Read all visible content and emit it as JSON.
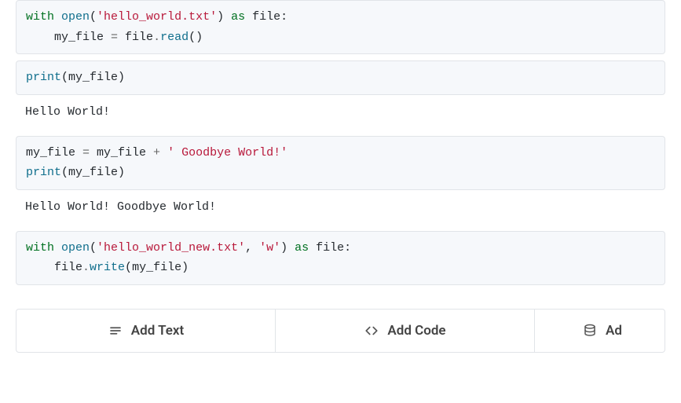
{
  "cells": [
    {
      "code_tokens": [
        [
          {
            "t": "with ",
            "c": "kw"
          },
          {
            "t": "open",
            "c": "fn"
          },
          {
            "t": "(",
            "c": "paren"
          },
          {
            "t": "'hello_world.txt'",
            "c": "str"
          },
          {
            "t": ")",
            "c": "paren"
          },
          {
            "t": " as ",
            "c": "kw"
          },
          {
            "t": "file",
            "c": "name-def"
          },
          {
            "t": ":",
            "c": "paren"
          }
        ],
        [
          {
            "t": "    my_file ",
            "c": "name-def"
          },
          {
            "t": "=",
            "c": "op"
          },
          {
            "t": " file",
            "c": "name-def"
          },
          {
            "t": ".",
            "c": "op"
          },
          {
            "t": "read",
            "c": "fn"
          },
          {
            "t": "()",
            "c": "paren"
          }
        ]
      ],
      "output": null
    },
    {
      "code_tokens": [
        [
          {
            "t": "print",
            "c": "fn"
          },
          {
            "t": "(",
            "c": "paren"
          },
          {
            "t": "my_file",
            "c": "name-def"
          },
          {
            "t": ")",
            "c": "paren"
          }
        ]
      ],
      "output": "Hello World!"
    },
    {
      "code_tokens": [
        [
          {
            "t": "my_file ",
            "c": "name-def"
          },
          {
            "t": "=",
            "c": "op"
          },
          {
            "t": " my_file ",
            "c": "name-def"
          },
          {
            "t": "+",
            "c": "op"
          },
          {
            "t": " ' Goodbye World!'",
            "c": "str"
          }
        ],
        [
          {
            "t": "print",
            "c": "fn"
          },
          {
            "t": "(",
            "c": "paren"
          },
          {
            "t": "my_file",
            "c": "name-def"
          },
          {
            "t": ")",
            "c": "paren"
          }
        ]
      ],
      "output": "Hello World! Goodbye World!"
    },
    {
      "code_tokens": [
        [
          {
            "t": "with ",
            "c": "kw"
          },
          {
            "t": "open",
            "c": "fn"
          },
          {
            "t": "(",
            "c": "paren"
          },
          {
            "t": "'hello_world_new.txt'",
            "c": "str"
          },
          {
            "t": ", ",
            "c": "paren"
          },
          {
            "t": "'w'",
            "c": "str"
          },
          {
            "t": ")",
            "c": "paren"
          },
          {
            "t": " as ",
            "c": "kw"
          },
          {
            "t": "file",
            "c": "name-def"
          },
          {
            "t": ":",
            "c": "paren"
          }
        ],
        [
          {
            "t": "    file",
            "c": "name-def"
          },
          {
            "t": ".",
            "c": "op"
          },
          {
            "t": "write",
            "c": "fn"
          },
          {
            "t": "(",
            "c": "paren"
          },
          {
            "t": "my_file",
            "c": "name-def"
          },
          {
            "t": ")",
            "c": "paren"
          }
        ]
      ],
      "output": null
    }
  ],
  "toolbar": {
    "add_text_label": "Add Text",
    "add_code_label": "Add Code",
    "add_label": "Ad"
  }
}
